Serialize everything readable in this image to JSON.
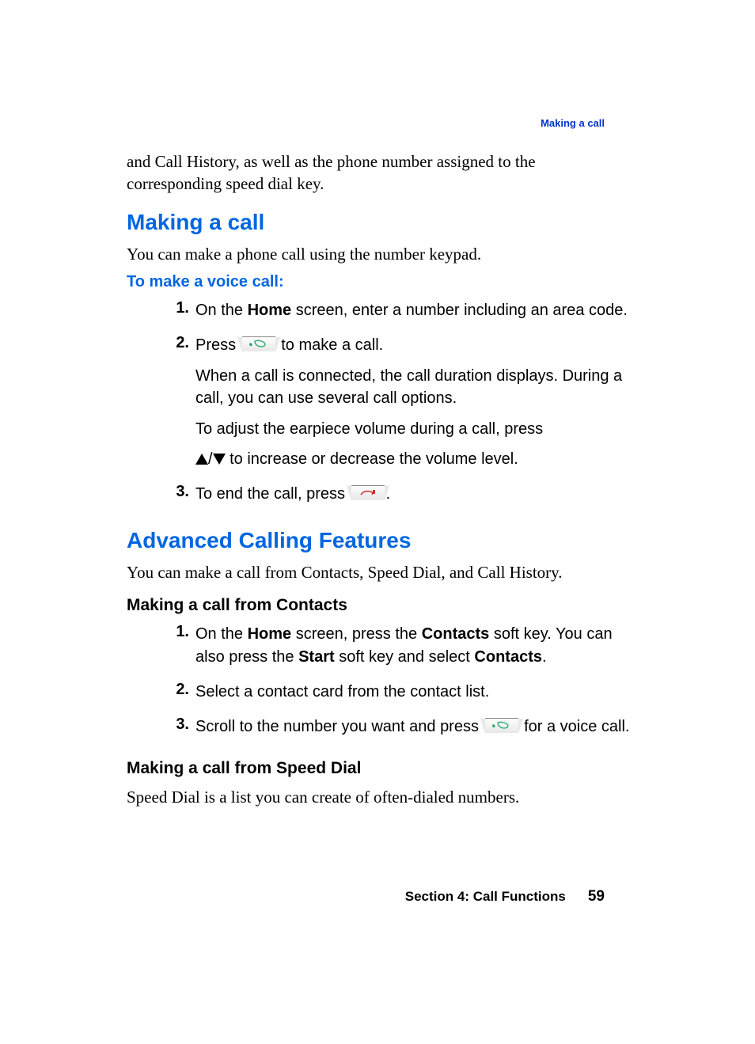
{
  "running_head": "Making a call",
  "intro_continuation": "and Call History, as well as the phone number assigned to the corresponding speed dial key.",
  "section1": {
    "heading": "Making a call",
    "intro": "You can make a phone call using the number keypad.",
    "sub": "To make a voice call:",
    "steps": {
      "s1_num": "1.",
      "s1_a": "On the ",
      "s1_home": "Home",
      "s1_b": " screen, enter a number including an area code.",
      "s2_num": "2.",
      "s2_a": "Press ",
      "s2_b": " to make a call.",
      "s2_p2": "When a call is connected, the call duration displays. During a call, you can use several call options.",
      "s2_p3": "To adjust the earpiece volume during a call, press",
      "s2_p4_mid": "/",
      "s2_p4_end": " to increase or decrease the volume level.",
      "s3_num": "3.",
      "s3_a": "To end the call, press ",
      "s3_b": "."
    }
  },
  "section2": {
    "heading": "Advanced Calling Features",
    "intro": "You can make a call from Contacts, Speed Dial, and Call History.",
    "sub1": {
      "heading": "Making a call from Contacts",
      "s1_num": "1.",
      "s1_a": "On the ",
      "s1_home": "Home",
      "s1_b": " screen, press the ",
      "s1_contacts": "Contacts",
      "s1_c": " soft key. You can also press the ",
      "s1_start": "Start",
      "s1_d": " soft key and select ",
      "s1_contacts2": "Contacts",
      "s1_e": ".",
      "s2_num": "2.",
      "s2": "Select a contact card from the contact list.",
      "s3_num": "3.",
      "s3_a": "Scroll to the number you want and press ",
      "s3_b": " for a voice call."
    },
    "sub2": {
      "heading": "Making a call from Speed Dial",
      "intro": "Speed Dial is a list you can create of often-dialed numbers."
    }
  },
  "footer": {
    "section": "Section 4: Call Functions",
    "page": "59"
  }
}
